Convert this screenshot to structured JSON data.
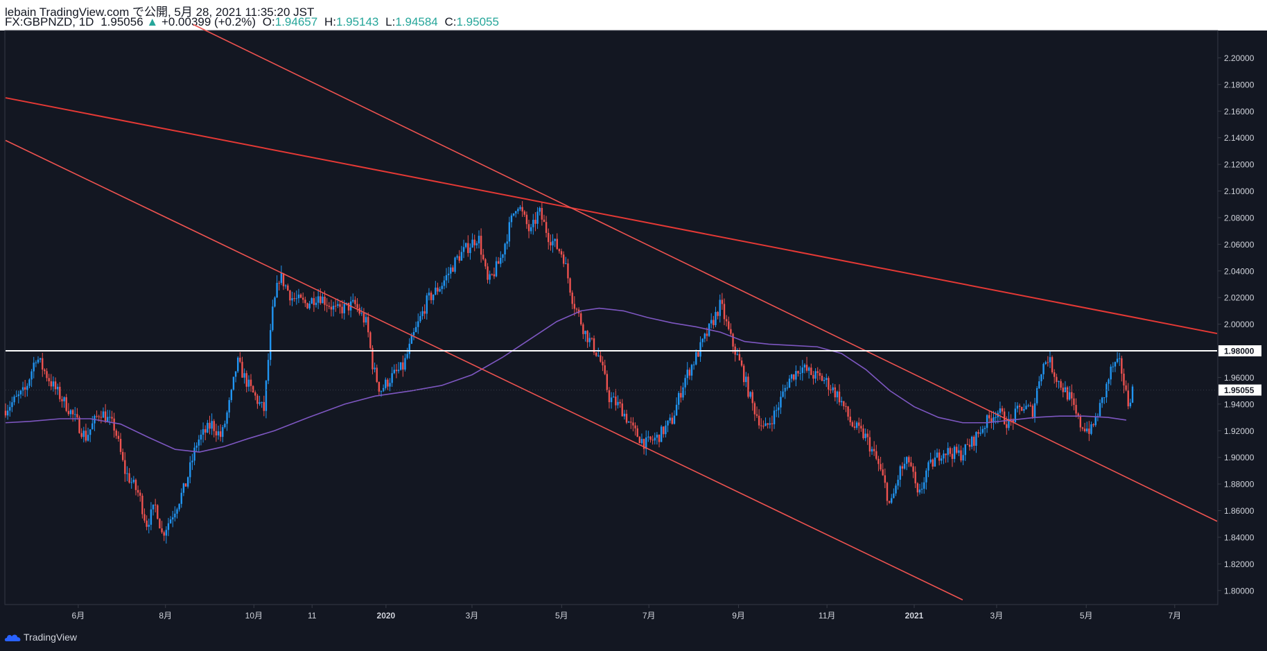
{
  "header": {
    "line1": "lebain TradingView.com で公開, 5月 28, 2021 11:35:20 JST",
    "symbol": "FX:GBPNZD, 1D",
    "last": "1.95056",
    "change_arrow": "▲",
    "change": "+0.00399 (+0.2%)",
    "open_label": "O:",
    "open": "1.94657",
    "high_label": "H:",
    "high": "1.95143",
    "low_label": "L:",
    "low": "1.94584",
    "close_label": "C:",
    "close": "1.95055"
  },
  "footer": {
    "brand": "TradingView",
    "logo_icon": "tradingview-cloud-icon"
  },
  "colors": {
    "background": "#131722",
    "up": "#2196f3",
    "down": "#ef5350",
    "trendline": "#ef5350",
    "trendline_strong": "#e53935",
    "moving_average": "#7e57c2",
    "level": "#ffffff",
    "price_tag": "#ffffff"
  },
  "chart_data": {
    "type": "candlestick",
    "symbol": "FX:GBPNZD",
    "interval": "1D",
    "ylim": [
      1.79,
      2.22
    ],
    "y_ticks": [
      "2.20000",
      "2.18000",
      "2.16000",
      "2.14000",
      "2.12000",
      "2.10000",
      "2.08000",
      "2.06000",
      "2.04000",
      "2.02000",
      "2.00000",
      "1.98000",
      "1.96000",
      "1.95055",
      "1.94000",
      "1.92000",
      "1.90000",
      "1.88000",
      "1.86000",
      "1.84000",
      "1.82000",
      "1.80000"
    ],
    "x_ticks": [
      {
        "label": "6月",
        "t": 0.06
      },
      {
        "label": "8月",
        "t": 0.132
      },
      {
        "label": "10月",
        "t": 0.205
      },
      {
        "label": "11",
        "t": 0.253
      },
      {
        "label": "2020",
        "t": 0.314
      },
      {
        "label": "3月",
        "t": 0.385
      },
      {
        "label": "5月",
        "t": 0.459
      },
      {
        "label": "7月",
        "t": 0.531
      },
      {
        "label": "9月",
        "t": 0.605
      },
      {
        "label": "11月",
        "t": 0.678
      },
      {
        "label": "2021",
        "t": 0.75
      },
      {
        "label": "3月",
        "t": 0.818
      },
      {
        "label": "5月",
        "t": 0.892
      },
      {
        "label": "7月",
        "t": 0.965
      }
    ],
    "price_path": [
      [
        0.0,
        1.935
      ],
      [
        0.018,
        1.95
      ],
      [
        0.027,
        1.976
      ],
      [
        0.04,
        1.955
      ],
      [
        0.055,
        1.935
      ],
      [
        0.068,
        1.915
      ],
      [
        0.08,
        1.935
      ],
      [
        0.092,
        1.922
      ],
      [
        0.1,
        1.89
      ],
      [
        0.112,
        1.872
      ],
      [
        0.118,
        1.85
      ],
      [
        0.126,
        1.864
      ],
      [
        0.131,
        1.842
      ],
      [
        0.14,
        1.858
      ],
      [
        0.15,
        1.878
      ],
      [
        0.16,
        1.912
      ],
      [
        0.172,
        1.925
      ],
      [
        0.18,
        1.915
      ],
      [
        0.188,
        1.946
      ],
      [
        0.193,
        1.972
      ],
      [
        0.2,
        1.958
      ],
      [
        0.206,
        1.948
      ],
      [
        0.215,
        1.935
      ],
      [
        0.222,
        2.008
      ],
      [
        0.228,
        2.037
      ],
      [
        0.238,
        2.02
      ],
      [
        0.25,
        2.015
      ],
      [
        0.26,
        2.022
      ],
      [
        0.275,
        2.01
      ],
      [
        0.29,
        2.015
      ],
      [
        0.3,
        2.0
      ],
      [
        0.305,
        1.968
      ],
      [
        0.311,
        1.95
      ],
      [
        0.32,
        1.96
      ],
      [
        0.33,
        1.968
      ],
      [
        0.338,
        1.99
      ],
      [
        0.35,
        2.018
      ],
      [
        0.362,
        2.03
      ],
      [
        0.375,
        2.05
      ],
      [
        0.392,
        2.066
      ],
      [
        0.4,
        2.03
      ],
      [
        0.41,
        2.048
      ],
      [
        0.418,
        2.074
      ],
      [
        0.424,
        2.092
      ],
      [
        0.435,
        2.068
      ],
      [
        0.442,
        2.085
      ],
      [
        0.45,
        2.066
      ],
      [
        0.462,
        2.052
      ],
      [
        0.47,
        2.018
      ],
      [
        0.48,
        1.994
      ],
      [
        0.492,
        1.975
      ],
      [
        0.5,
        1.945
      ],
      [
        0.51,
        1.937
      ],
      [
        0.52,
        1.92
      ],
      [
        0.53,
        1.91
      ],
      [
        0.54,
        1.915
      ],
      [
        0.552,
        1.928
      ],
      [
        0.562,
        1.958
      ],
      [
        0.572,
        1.976
      ],
      [
        0.582,
        1.995
      ],
      [
        0.592,
        2.015
      ],
      [
        0.6,
        1.99
      ],
      [
        0.61,
        1.965
      ],
      [
        0.618,
        1.94
      ],
      [
        0.628,
        1.92
      ],
      [
        0.638,
        1.935
      ],
      [
        0.648,
        1.958
      ],
      [
        0.658,
        1.968
      ],
      [
        0.668,
        1.962
      ],
      [
        0.678,
        1.958
      ],
      [
        0.69,
        1.945
      ],
      [
        0.7,
        1.925
      ],
      [
        0.712,
        1.915
      ],
      [
        0.722,
        1.895
      ],
      [
        0.728,
        1.878
      ],
      [
        0.732,
        1.862
      ],
      [
        0.74,
        1.89
      ],
      [
        0.748,
        1.898
      ],
      [
        0.755,
        1.868
      ],
      [
        0.762,
        1.89
      ],
      [
        0.775,
        1.905
      ],
      [
        0.79,
        1.902
      ],
      [
        0.8,
        1.912
      ],
      [
        0.81,
        1.925
      ],
      [
        0.82,
        1.935
      ],
      [
        0.83,
        1.925
      ],
      [
        0.84,
        1.938
      ],
      [
        0.85,
        1.935
      ],
      [
        0.856,
        1.965
      ],
      [
        0.862,
        1.975
      ],
      [
        0.87,
        1.958
      ],
      [
        0.88,
        1.945
      ],
      [
        0.888,
        1.925
      ],
      [
        0.898,
        1.92
      ],
      [
        0.908,
        1.945
      ],
      [
        0.915,
        1.968
      ],
      [
        0.922,
        1.97
      ],
      [
        0.928,
        1.94
      ],
      [
        0.932,
        1.951
      ]
    ],
    "moving_average": [
      [
        0.0,
        1.926
      ],
      [
        0.02,
        1.927
      ],
      [
        0.045,
        1.929
      ],
      [
        0.07,
        1.929
      ],
      [
        0.095,
        1.925
      ],
      [
        0.118,
        1.915
      ],
      [
        0.14,
        1.906
      ],
      [
        0.16,
        1.904
      ],
      [
        0.18,
        1.908
      ],
      [
        0.2,
        1.914
      ],
      [
        0.222,
        1.92
      ],
      [
        0.25,
        1.93
      ],
      [
        0.28,
        1.94
      ],
      [
        0.305,
        1.946
      ],
      [
        0.335,
        1.95
      ],
      [
        0.36,
        1.954
      ],
      [
        0.385,
        1.962
      ],
      [
        0.41,
        1.975
      ],
      [
        0.435,
        1.99
      ],
      [
        0.455,
        2.002
      ],
      [
        0.475,
        2.01
      ],
      [
        0.49,
        2.012
      ],
      [
        0.51,
        2.01
      ],
      [
        0.53,
        2.005
      ],
      [
        0.55,
        2.001
      ],
      [
        0.57,
        1.998
      ],
      [
        0.59,
        1.994
      ],
      [
        0.61,
        1.987
      ],
      [
        0.63,
        1.985
      ],
      [
        0.65,
        1.984
      ],
      [
        0.67,
        1.983
      ],
      [
        0.69,
        1.978
      ],
      [
        0.71,
        1.966
      ],
      [
        0.73,
        1.95
      ],
      [
        0.75,
        1.938
      ],
      [
        0.77,
        1.93
      ],
      [
        0.79,
        1.926
      ],
      [
        0.81,
        1.926
      ],
      [
        0.83,
        1.928
      ],
      [
        0.85,
        1.93
      ],
      [
        0.87,
        1.931
      ],
      [
        0.89,
        1.931
      ],
      [
        0.91,
        1.93
      ],
      [
        0.925,
        1.928
      ]
    ],
    "trendlines": [
      {
        "name": "upper-resistance",
        "t1": 0.0,
        "y1": 2.17,
        "t2": 1.0,
        "y2": 1.993,
        "strong": true
      },
      {
        "name": "steep-descending",
        "t1": 0.155,
        "y1": 2.225,
        "t2": 1.0,
        "y2": 1.852
      },
      {
        "name": "lower-channel",
        "t1": 0.0,
        "y1": 2.138,
        "t2": 0.79,
        "y2": 1.793
      }
    ],
    "level": {
      "price": 1.98,
      "label": "1.98000"
    },
    "last_price": {
      "price": 1.95055,
      "label": "1.95055"
    },
    "total_bars": 520,
    "brand": "TradingView"
  }
}
